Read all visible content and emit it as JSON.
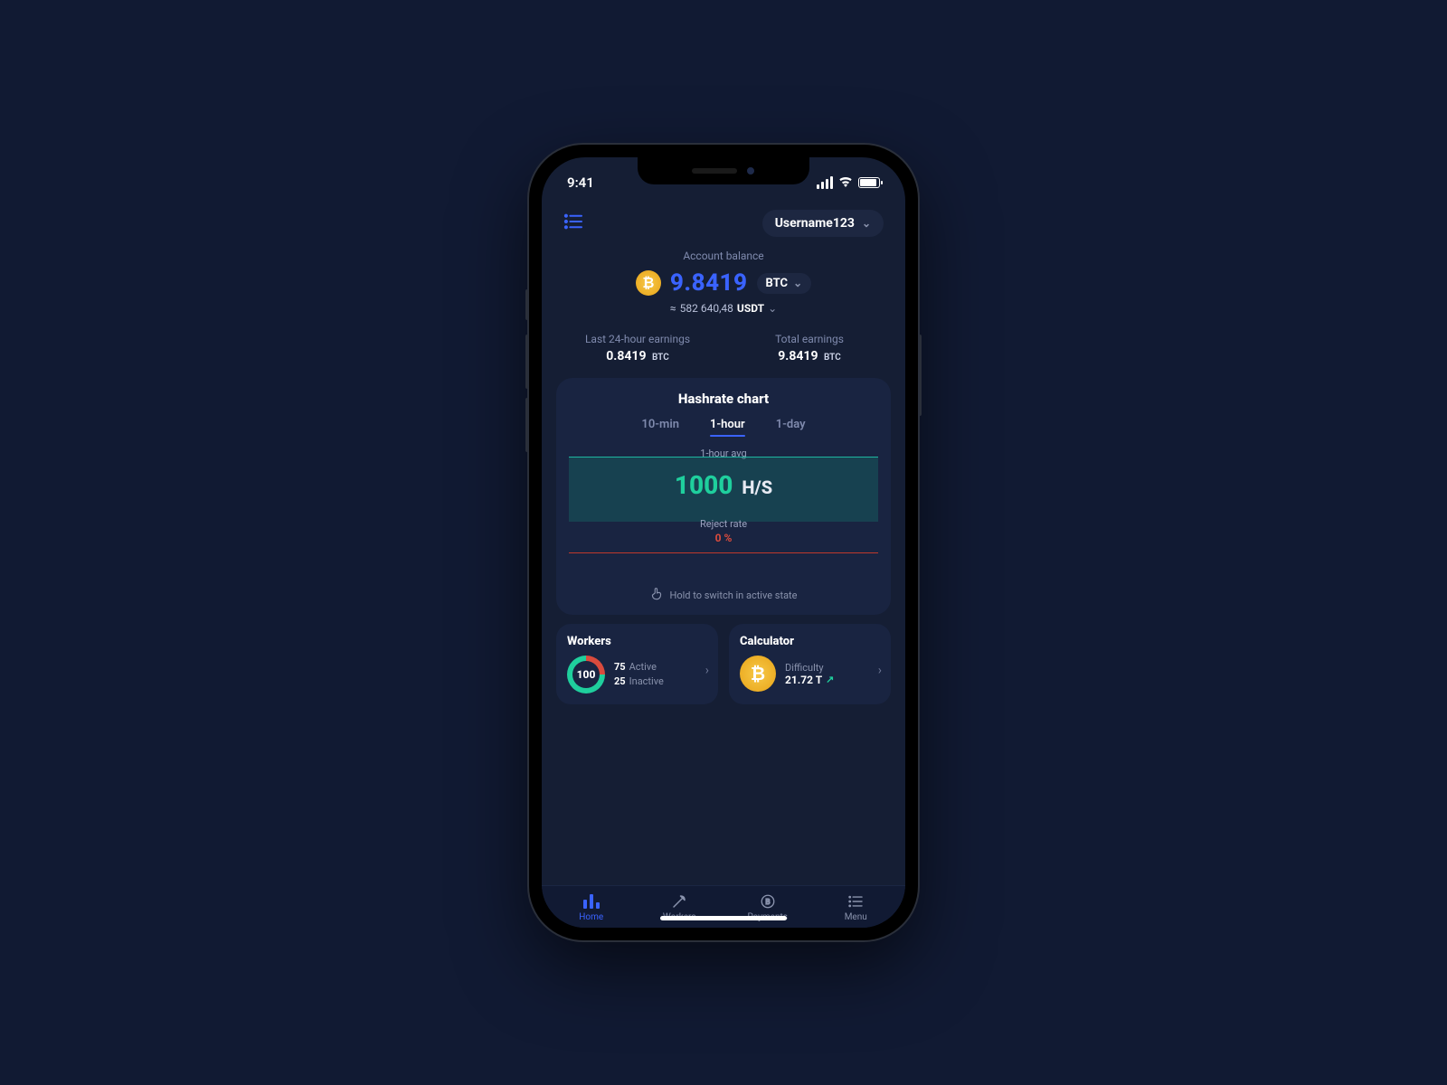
{
  "status": {
    "time": "9:41"
  },
  "header": {
    "username": "Username123"
  },
  "balance": {
    "label": "Account balance",
    "amount": "9.8419",
    "unit": "BTC",
    "converted_prefix": "≈",
    "converted_amount": "582 640,48",
    "converted_unit": "USDT"
  },
  "earnings": {
    "last24_label": "Last 24-hour earnings",
    "last24_amount": "0.8419",
    "last24_unit": "BTC",
    "total_label": "Total earnings",
    "total_amount": "9.8419",
    "total_unit": "BTC"
  },
  "hashrate": {
    "title": "Hashrate chart",
    "tabs": {
      "t10": "10-min",
      "t1h": "1-hour",
      "t1d": "1-day"
    },
    "avg_label": "1-hour avg",
    "avg_value": "1000",
    "avg_unit": "H/S",
    "reject_label": "Reject rate",
    "reject_value": "0",
    "reject_unit": "%",
    "hint": "Hold to switch in active state"
  },
  "workers_card": {
    "title": "Workers",
    "total": "100",
    "active_count": "75",
    "active_label": "Active",
    "inactive_count": "25",
    "inactive_label": "Inactive"
  },
  "calculator_card": {
    "title": "Calculator",
    "difficulty_label": "Difficulty",
    "difficulty_value": "21.72 T"
  },
  "nav": {
    "home": "Home",
    "workers": "Workers",
    "payments": "Payments",
    "menu": "Menu"
  }
}
